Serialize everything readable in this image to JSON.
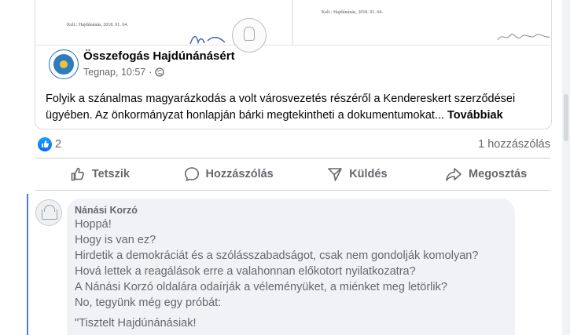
{
  "shared_card": {
    "doc_date_left": "Kelt.: Hajdúnánás, 2018. 01. 04.",
    "doc_date_right": "Kelt.: Hajdúnánás, 2018. 01. 04."
  },
  "post": {
    "page_name": "Összefogás Hajdúnánásért",
    "time": "Tegnap, 10:57",
    "separator": "·",
    "audience_icon": "globe-icon",
    "text": "Folyik a szánalmas magyarázkodás a volt városvezetés részéről a Kendereskert szerződései ügyében. Az önkormányzat honlapján bárki megtekintheti a dokumentumokat...",
    "see_more": "Továbbiak"
  },
  "reactions": {
    "count": "2",
    "comments": "1 hozzászólás",
    "like_color": "#0866ff"
  },
  "actions": [
    {
      "label": "Tetszik",
      "icon": "thumbs-up-icon"
    },
    {
      "label": "Hozzászólás",
      "icon": "comment-bubble-icon"
    },
    {
      "label": "Küldés",
      "icon": "send-icon"
    },
    {
      "label": "Megosztás",
      "icon": "share-icon"
    }
  ],
  "comment": {
    "author": "Nánási Korzó",
    "lines": [
      "Hoppá!",
      "Hogy is van ez?",
      "Hirdetik a demokráciát és a szólásszabadságot, csak nem gondolják komolyan?",
      "Hová lettek a reagálások erre a valahonnan előkotort nyilatkozatra?",
      "A Nánási Korzó oldalára odaírják a véleményüket, a miénket meg letörlik?",
      "No, tegyünk még egy próbát:"
    ],
    "quote_start": "\"Tisztelt Hajdúnánásiak!"
  },
  "colors": {
    "thread_line": "#4b7ae8",
    "muted_text": "#65676b"
  }
}
